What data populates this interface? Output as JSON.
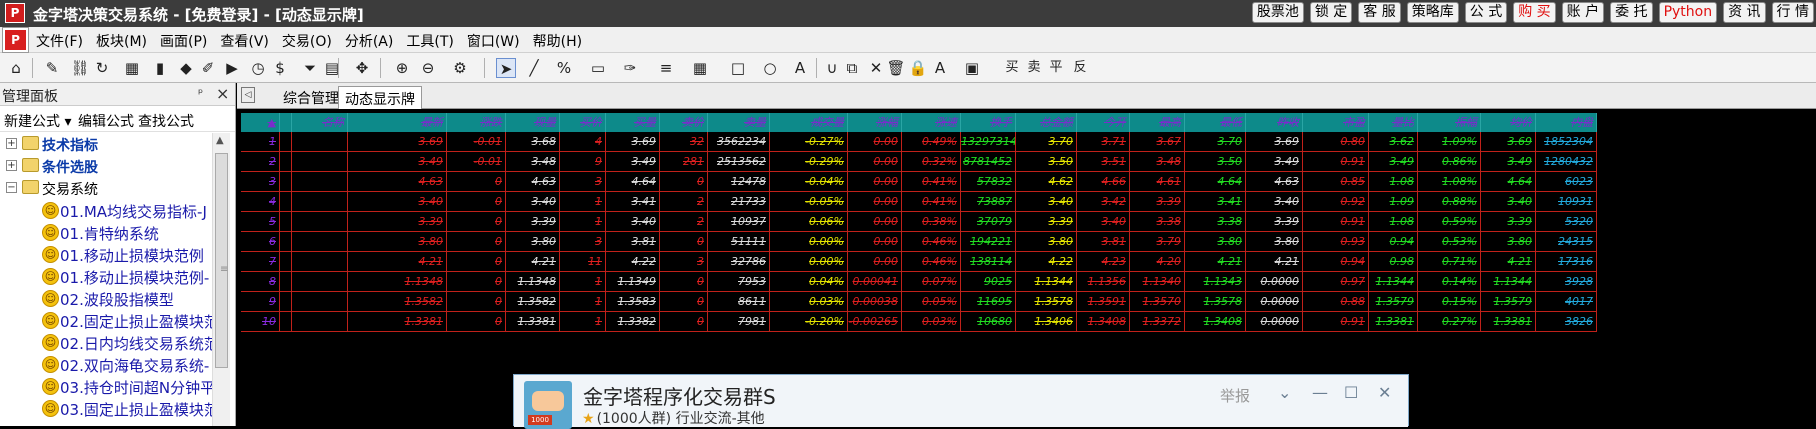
{
  "window": {
    "title": "金字塔决策交易系统 - [免费登录] - [动态显示牌]",
    "top_buttons": [
      {
        "label": "股票池",
        "red": false
      },
      {
        "label": "锁 定",
        "red": false
      },
      {
        "label": "客 服",
        "red": false
      },
      {
        "label": "策略库",
        "red": false
      },
      {
        "label": "公 式",
        "red": false
      },
      {
        "label": "购 买",
        "red": true
      },
      {
        "label": "账 户",
        "red": false
      },
      {
        "label": "委 托",
        "red": false
      },
      {
        "label": "Python",
        "red": true
      },
      {
        "label": "资 讯",
        "red": false
      },
      {
        "label": "行 情",
        "red": false
      }
    ]
  },
  "menubar": {
    "items": [
      "文件(F)",
      "板块(M)",
      "画面(P)",
      "查看(V)",
      "交易(O)",
      "分析(A)",
      "工具(T)",
      "窗口(W)",
      "帮助(H)"
    ]
  },
  "toolbar": {
    "icons": [
      "home-icon",
      "pencil-icon",
      "link-icon",
      "refresh-icon",
      "layout-icon",
      "candlestick-icon",
      "diamond-icon",
      "edit-icon",
      "play-icon",
      "timer-icon",
      "dollar-icon",
      "filter-icon",
      "grid-icon",
      "move-icon",
      "zoom-in-icon",
      "zoom-out-icon",
      "settings-icon",
      "cursor-icon",
      "line-icon",
      "percent-icon",
      "ruler-icon",
      "pen-icon",
      "channel-icon",
      "table-icon",
      "rectangle-icon",
      "circle-icon",
      "text-icon",
      "magnet-icon",
      "copy-icon",
      "delete-icon",
      "trash-icon",
      "lock-icon",
      "color-icon",
      "save-icon",
      "buy-icon",
      "sell-icon",
      "flat-icon",
      "reverse-icon"
    ]
  },
  "sidebar": {
    "title": "管理面板",
    "pin": "ᵖ",
    "close": "×",
    "actions": [
      "新建公式 ▾",
      "编辑公式",
      "查找公式"
    ],
    "tree": [
      {
        "label": "技术指标",
        "kind": "folder",
        "expander": "+"
      },
      {
        "label": "条件选股",
        "kind": "folder",
        "expander": "+"
      },
      {
        "label": "交易系统",
        "kind": "folder-open",
        "expander": "−"
      },
      {
        "label": "01.MA均线交易指标-J",
        "kind": "leaf"
      },
      {
        "label": "01.肯特纳系统",
        "kind": "leaf"
      },
      {
        "label": "01.移动止损模块范例",
        "kind": "leaf"
      },
      {
        "label": "01.移动止损模块范例-",
        "kind": "leaf"
      },
      {
        "label": "02.波段股指模型",
        "kind": "leaf"
      },
      {
        "label": "02.固定止损止盈模块范",
        "kind": "leaf"
      },
      {
        "label": "02.日内均线交易系统范",
        "kind": "leaf"
      },
      {
        "label": "02.双向海龟交易系统-",
        "kind": "leaf"
      },
      {
        "label": "03.持仓时间超N分钟平",
        "kind": "leaf"
      },
      {
        "label": "03.固定止损止盈模块范",
        "kind": "leaf"
      }
    ]
  },
  "tabs": {
    "nav": "◁",
    "items": [
      "综合管理",
      "动态显示牌"
    ],
    "active": 1
  },
  "grid": {
    "header_color": "#0d8a8a",
    "line_color": "#c0211a",
    "headers": [
      "▲",
      "",
      "名称",
      "最新",
      "涨跌",
      "现量",
      "买价",
      "买量",
      "卖价",
      "卖量",
      "成交量",
      "涨幅",
      "涨速",
      "换手",
      "总金额",
      "今开",
      "最高",
      "最低",
      "昨收",
      "市盈",
      "量比",
      "振幅",
      "均价",
      "内盘"
    ],
    "rows": [
      [
        "1",
        "",
        "",
        "3.69",
        "-0.01",
        "3.68",
        "4",
        "3.69",
        "32",
        "3562234",
        "-0.27%",
        "0.00",
        "0.49%",
        "13297314",
        "3.70",
        "3.71",
        "3.67",
        "3.70",
        "3.69",
        "0.80",
        "3.62",
        "1.09%",
        "3.69",
        "1852304"
      ],
      [
        "2",
        "",
        "",
        "3.49",
        "-0.01",
        "3.48",
        "9",
        "3.49",
        "281",
        "2513562",
        "-0.29%",
        "0.00",
        "0.32%",
        "8781452",
        "3.50",
        "3.51",
        "3.48",
        "3.50",
        "3.49",
        "0.91",
        "3.49",
        "0.86%",
        "3.49",
        "1280432"
      ],
      [
        "3",
        "",
        "",
        "4.63",
        "0",
        "4.63",
        "3",
        "4.64",
        "0",
        "12478",
        "-0.04%",
        "0.00",
        "0.41%",
        "57832",
        "4.62",
        "4.66",
        "4.61",
        "4.64",
        "4.63",
        "0.85",
        "1.08",
        "1.08%",
        "4.64",
        "6023"
      ],
      [
        "4",
        "",
        "",
        "3.40",
        "0",
        "3.40",
        "1",
        "3.41",
        "2",
        "21733",
        "-0.05%",
        "0.00",
        "0.41%",
        "73887",
        "3.40",
        "3.42",
        "3.39",
        "3.41",
        "3.40",
        "0.92",
        "1.09",
        "0.88%",
        "3.40",
        "10931"
      ],
      [
        "5",
        "",
        "",
        "3.39",
        "0",
        "3.39",
        "1",
        "3.40",
        "2",
        "10937",
        "0.06%",
        "0.00",
        "0.38%",
        "37079",
        "3.39",
        "3.40",
        "3.38",
        "3.38",
        "3.39",
        "0.91",
        "1.08",
        "0.59%",
        "3.39",
        "5320"
      ],
      [
        "6",
        "",
        "",
        "3.80",
        "0",
        "3.80",
        "3",
        "3.81",
        "0",
        "51111",
        "0.00%",
        "0.00",
        "0.46%",
        "194221",
        "3.80",
        "3.81",
        "3.79",
        "3.80",
        "3.80",
        "0.93",
        "0.94",
        "0.53%",
        "3.80",
        "24315"
      ],
      [
        "7",
        "",
        "",
        "4.21",
        "0",
        "4.21",
        "11",
        "4.22",
        "3",
        "32786",
        "0.00%",
        "0.00",
        "0.46%",
        "138114",
        "4.22",
        "4.23",
        "4.20",
        "4.21",
        "4.21",
        "0.94",
        "0.98",
        "0.71%",
        "4.21",
        "17316"
      ],
      [
        "8",
        "",
        "",
        "1.1348",
        "0",
        "1.1348",
        "1",
        "1.1349",
        "0",
        "7953",
        "0.04%",
        "0.00041",
        "0.07%",
        "9025",
        "1.1344",
        "1.1356",
        "1.1340",
        "1.1343",
        "0.0000",
        "0.97",
        "1.1344",
        "0.14%",
        "1.1344",
        "3928"
      ],
      [
        "9",
        "",
        "",
        "1.3582",
        "0",
        "1.3582",
        "1",
        "1.3583",
        "0",
        "8611",
        "0.03%",
        "0.00038",
        "0.05%",
        "11695",
        "1.3578",
        "1.3591",
        "1.3570",
        "1.3578",
        "0.0000",
        "0.88",
        "1.3579",
        "0.15%",
        "1.3579",
        "4017"
      ],
      [
        "10",
        "",
        "",
        "1.3381",
        "0",
        "1.3381",
        "1",
        "1.3382",
        "0",
        "7981",
        "-0.20%",
        "-0.00265",
        "0.03%",
        "10680",
        "1.3406",
        "1.3408",
        "1.3372",
        "1.3408",
        "0.0000",
        "0.91",
        "1.3381",
        "0.27%",
        "1.3381",
        "3826"
      ]
    ]
  },
  "popup": {
    "title": "金字塔程序化交易群S",
    "subtitle": "(1000人群) 行业交流-其他",
    "star": "★",
    "report": "举报",
    "controls": [
      "⌄",
      "—",
      "☐",
      "✕"
    ],
    "avatar_tag": "1000"
  }
}
